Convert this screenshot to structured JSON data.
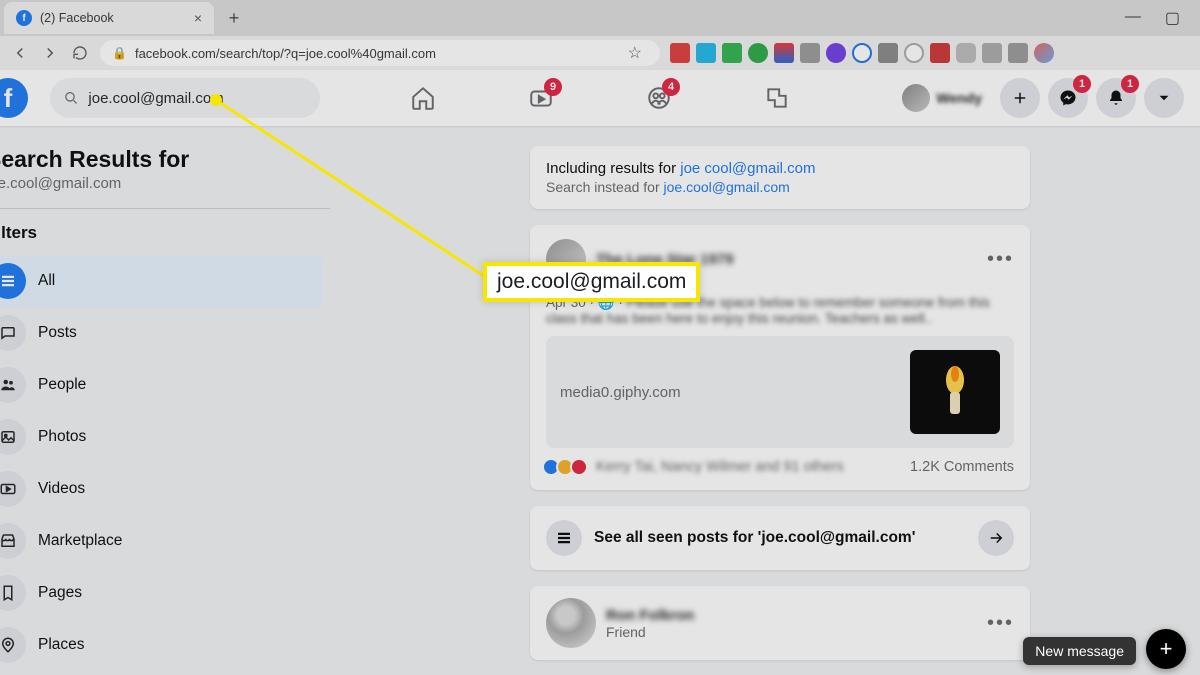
{
  "browser": {
    "tab_title": "(2) Facebook",
    "url": "facebook.com/search/top/?q=joe.cool%40gmail.com"
  },
  "header": {
    "search_value": "joe.cool@gmail.com",
    "badges": {
      "watch": "9",
      "groups": "4",
      "messenger": "1",
      "notifications": "1"
    },
    "profile_name": "Wendy"
  },
  "sidebar": {
    "title": "Search Results for",
    "query": "joe.cool@gmail.com",
    "filters_label": "Filters",
    "items": [
      {
        "label": "All"
      },
      {
        "label": "Posts"
      },
      {
        "label": "People"
      },
      {
        "label": "Photos"
      },
      {
        "label": "Videos"
      },
      {
        "label": "Marketplace"
      },
      {
        "label": "Pages"
      },
      {
        "label": "Places"
      }
    ]
  },
  "content": {
    "including_prefix": "Including results for ",
    "including_link": "joe cool@gmail.com",
    "instead_prefix": "Search instead for ",
    "instead_link": "joe.cool@gmail.com",
    "highlight_email": "joe.cool@gmail.com",
    "post": {
      "date": "Apr 30",
      "globe": "🌐",
      "blurred_title": "The Lone Star 1979",
      "blurred_body": "Please use the space below to remember someone from this class that has been here to enjoy this reunion. Teachers as well..",
      "link_text": "media0.giphy.com",
      "comments": "1.2K Comments",
      "blurred_reactions": "Kerry Tai, Nancy Wilmer and 91 others"
    },
    "see_all": "See all seen posts for 'joe.cool@gmail.com'",
    "friend": {
      "name": "Ron Folkron",
      "sub": "Friend"
    }
  },
  "footer": {
    "new_message": "New message"
  }
}
